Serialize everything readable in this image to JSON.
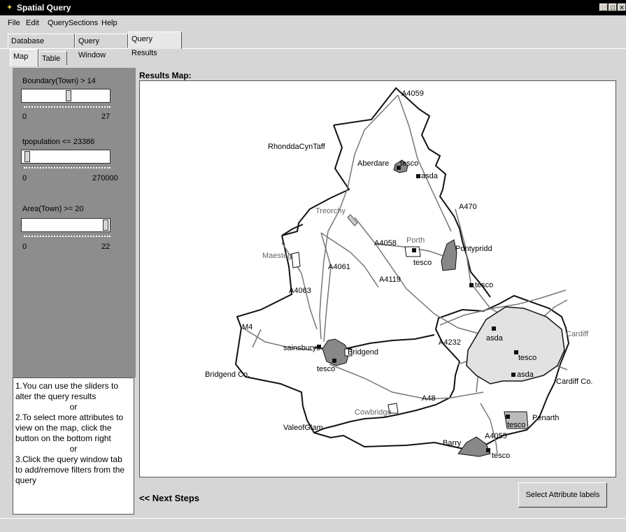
{
  "window": {
    "title": "Spatial Query",
    "min": "_",
    "max": "□",
    "close": "✕"
  },
  "menu": [
    "File",
    "Edit",
    "QuerySections",
    "Help"
  ],
  "tabs": [
    "Database Schema",
    "Query Window",
    "Query Results"
  ],
  "subtabs": [
    "Map",
    "Table"
  ],
  "sliders": [
    {
      "label": "Boundary(Town) >  14",
      "min": "0",
      "max": "27",
      "value": 14
    },
    {
      "label": "tpopulation  <= 23386",
      "min": "0",
      "max": "270000",
      "value": 23386
    },
    {
      "label": "Area(Town) >= 20",
      "min": "0",
      "max": "22",
      "value": 20
    }
  ],
  "instructions": {
    "l1": "1.You can use the sliders to alter the query results",
    "or1": "or",
    "l2": "2.To select more attributes to view on the map, click the button on the bottom right",
    "or2": "or",
    "l3": "3.Click the query window tab to add/remove filters from the query"
  },
  "results_label": "Results Map:",
  "next_steps": "<< Next Steps",
  "select_button": "Select Attribute labels",
  "map_labels": {
    "A4059": "A4059",
    "Rhondda": "RhonddaCynTaff",
    "Aberdare": "Aberdare",
    "tesco1": "tesco",
    "asda1": "asda",
    "A470": "A470",
    "Treorchy": "Treorchy",
    "Porth": "Porth",
    "A4058": "A4058",
    "Pontypridd": "Pontypridd",
    "tesco2": "tesco",
    "Maesteg": "Maesteg",
    "A4061": "A4061",
    "A4119": "A4119",
    "tesco3": "tesco",
    "A4063": "A4063",
    "M4": "M4",
    "sainsburys": "sainsburys",
    "Bridgend": "Bridgend",
    "tesco4": "tesco",
    "asda2": "asda",
    "tesco5": "tesco",
    "asda3": "asda",
    "Cardiff": "Cardiff",
    "CardiffCo": "Cardiff Co.",
    "A4232": "A4232",
    "BridgendCo": "Bridgend Co.",
    "A48": "A48",
    "Cowbridge": "Cowbridge",
    "Penarth": "Penarth",
    "tesco6": "tesco",
    "ValeofGlam": "ValeofGlam",
    "A4055": "A4055",
    "Barry": "Barry",
    "tesco7": "tesco"
  }
}
